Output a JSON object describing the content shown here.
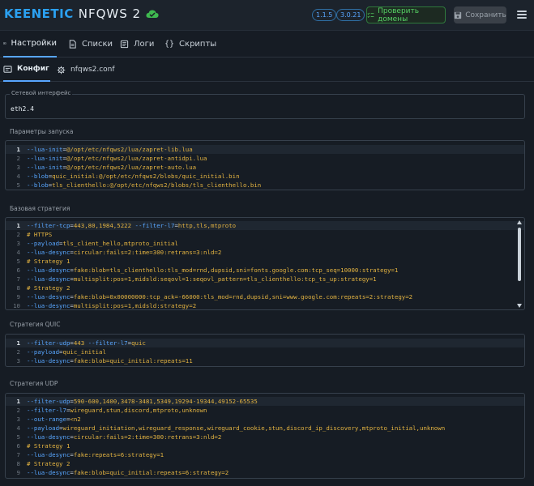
{
  "brand": {
    "name": "KEENETIC",
    "product": "NFQWS 2"
  },
  "header": {
    "version1": "1.1.5",
    "version2": "3.0.21",
    "check_label": "Проверить домены",
    "save_label": "Сохранить"
  },
  "tabs": [
    {
      "label": "Настройки"
    },
    {
      "label": "Списки"
    },
    {
      "label": "Логи"
    },
    {
      "label": "Скрипты"
    }
  ],
  "subtabs": [
    {
      "label": "Конфиг"
    },
    {
      "label": "nfqws2.conf"
    }
  ],
  "iface": {
    "legend": "Сетевой интерфейс",
    "value": "eth2.4"
  },
  "sections": {
    "launch": "Параметры запуска",
    "base": "Базовая стратегия",
    "quic": "Стратегия QUIC",
    "udp": "Стратегия UDP"
  },
  "launch_lines": [
    {
      "n": "1",
      "k": "--lua-init",
      "v": "@/opt/etc/nfqws2/lua/zapret-lib.lua"
    },
    {
      "n": "2",
      "k": "--lua-init",
      "v": "@/opt/etc/nfqws2/lua/zapret-antidpi.lua"
    },
    {
      "n": "3",
      "k": "--lua-init",
      "v": "@/opt/etc/nfqws2/lua/zapret-auto.lua"
    },
    {
      "n": "4",
      "k": "--blob",
      "v": "quic_initial:@/opt/etc/nfqws2/blobs/quic_initial.bin"
    },
    {
      "n": "5",
      "k": "--blob",
      "v": "tls_clienthello:@/opt/etc/nfqws2/blobs/tls_clienthello.bin"
    }
  ],
  "base_lines": [
    {
      "n": "1",
      "k": "--filter-tcp",
      "v": "443,80,1984,5222",
      "k2": "--filter-l7",
      "v2": "http,tls,mtproto"
    },
    {
      "n": "2",
      "c": "# HTTPS"
    },
    {
      "n": "3",
      "k": "--payload",
      "v": "tls_client_hello,mtproto_initial"
    },
    {
      "n": "4",
      "k": "--lua-desync",
      "v": "circular:fails=2:time=300:retrans=3:nld=2"
    },
    {
      "n": "5",
      "c": "# Strategy 1"
    },
    {
      "n": "6",
      "k": "--lua-desync",
      "v": "fake:blob=tls_clienthello:tls_mod=rnd,dupsid,sni=fonts.google.com:tcp_seq=10000:strategy=1"
    },
    {
      "n": "7",
      "k": "--lua-desync",
      "v": "multisplit:pos=1,midsld:seqovl=1:seqovl_pattern=tls_clienthello:tcp_ts_up:strategy=1"
    },
    {
      "n": "8",
      "c": "# Strategy 2"
    },
    {
      "n": "9",
      "k": "--lua-desync",
      "v": "fake:blob=0x00000000:tcp_ack=-66000:tls_mod=rnd,dupsid,sni=www.google.com:repeats=2:strategy=2"
    },
    {
      "n": "10",
      "k": "--lua-desync",
      "v": "multisplit:pos=1,midsld:strategy=2"
    }
  ],
  "quic_lines": [
    {
      "n": "1",
      "k": "--filter-udp",
      "v": "443",
      "k2": "--filter-l7",
      "v2": "quic"
    },
    {
      "n": "2",
      "k": "--payload",
      "v": "quic_initial"
    },
    {
      "n": "3",
      "k": "--lua-desync",
      "v": "fake:blob=quic_initial:repeats=11"
    }
  ],
  "udp_lines": [
    {
      "n": "1",
      "k": "--filter-udp",
      "v": "590-600,1400,3478-3481,5349,19294-19344,49152-65535"
    },
    {
      "n": "2",
      "k": "--filter-l7",
      "v": "wireguard,stun,discord,mtproto,unknown"
    },
    {
      "n": "3",
      "k": "--out-range",
      "v": "<n2"
    },
    {
      "n": "4",
      "k": "--payload",
      "v": "wireguard_initiation,wireguard_response,wireguard_cookie,stun,discord_ip_discovery,mtproto_initial,unknown"
    },
    {
      "n": "5",
      "k": "--lua-desync",
      "v": "circular:fails=2:time=300:retrans=3:nld=2"
    },
    {
      "n": "6",
      "c": "# Strategy 1"
    },
    {
      "n": "7",
      "k": "--lua-desync",
      "v": "fake:repeats=6:strategy=1"
    },
    {
      "n": "8",
      "c": "# Strategy 2"
    },
    {
      "n": "9",
      "k": "--lua-desync",
      "v": "fake:blob=quic_initial:repeats=6:strategy=2"
    }
  ]
}
